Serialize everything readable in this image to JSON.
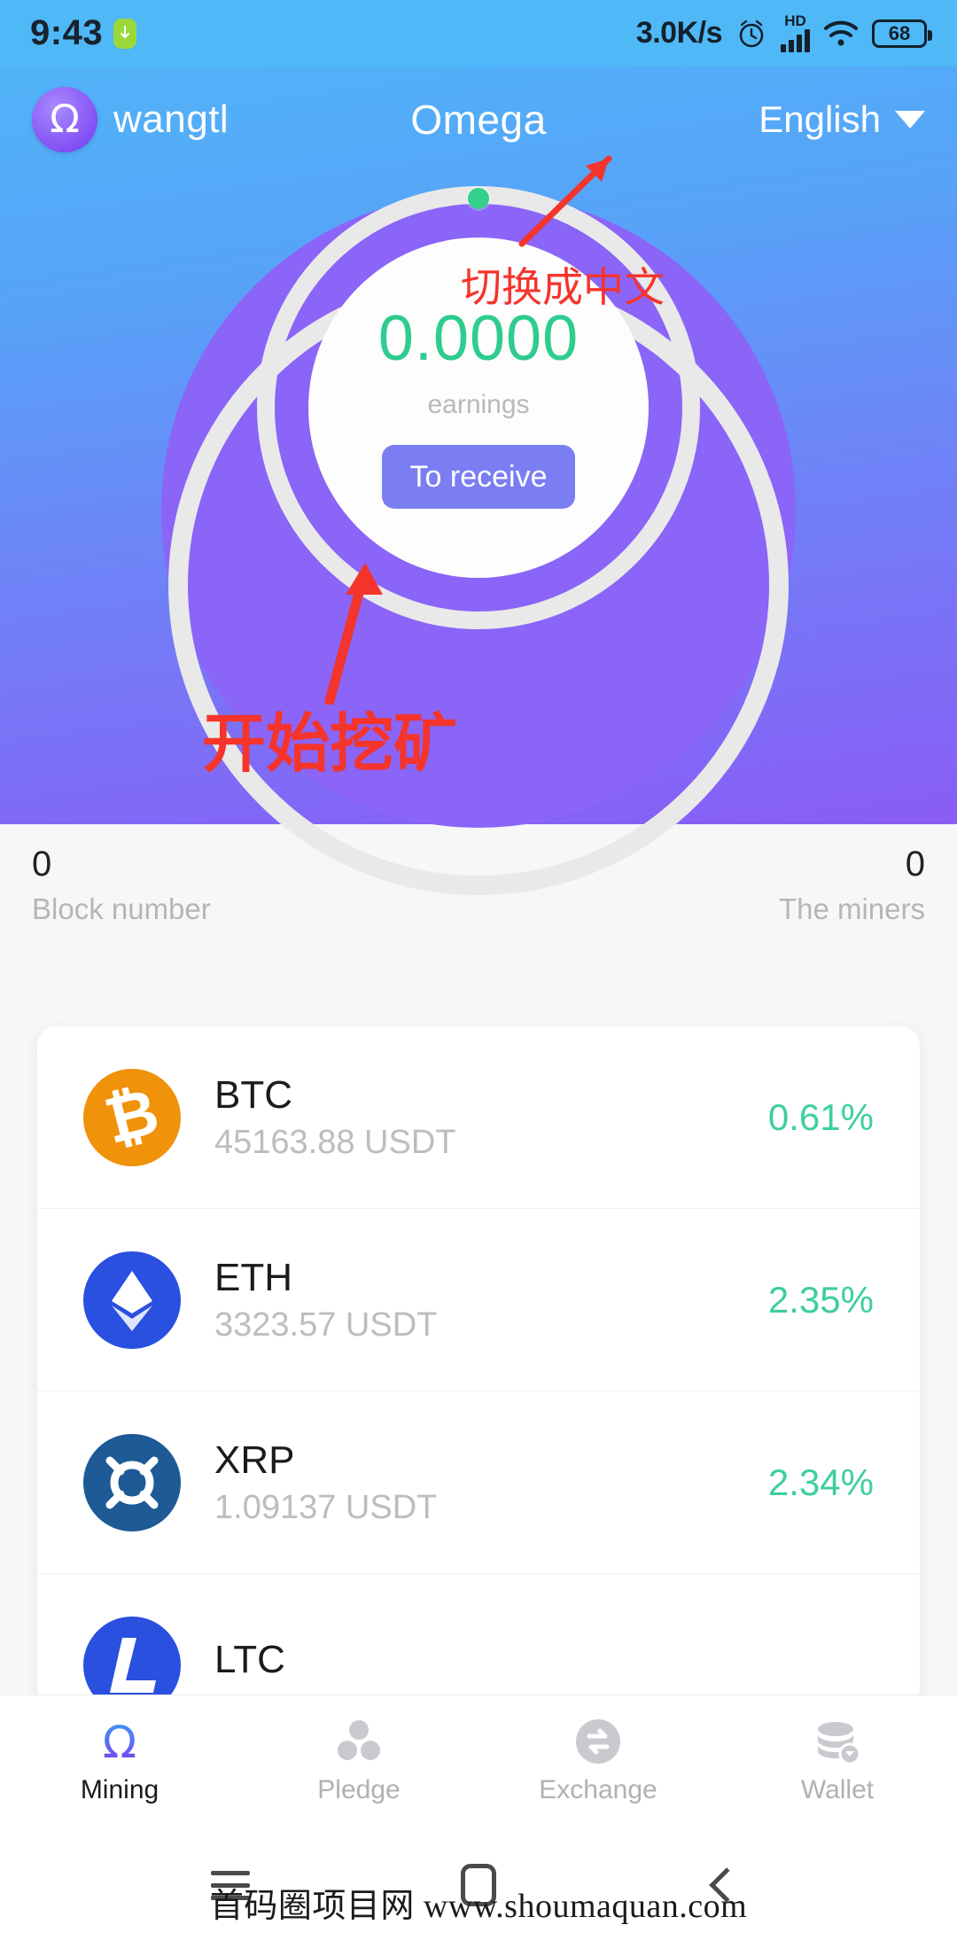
{
  "status_bar": {
    "time": "9:43",
    "download_icon": "download-badge-icon",
    "network_speed": "3.0K/s",
    "alarm_icon": "alarm-clock-icon",
    "hd_label": "HD",
    "signal_icon": "signal-bars-icon",
    "wifi_icon": "wifi-icon",
    "battery_level": "68"
  },
  "app_bar": {
    "logo_glyph": "Ω",
    "username": "wangtl",
    "title": "Omega",
    "language": "English",
    "caret_icon": "chevron-down-icon"
  },
  "earnings_ring": {
    "value": "0.0000",
    "label": "earnings",
    "button_label": "To receive",
    "dot_color": "#35d08b",
    "value_color": "#2ecc8f",
    "button_color": "#7b7ef3"
  },
  "stats": [
    {
      "value": "0",
      "label": "Block number"
    },
    {
      "value": "0",
      "label": "The miners"
    }
  ],
  "coins": [
    {
      "symbol": "BTC",
      "price": "45163.88 USDT",
      "change": "0.61%",
      "icon": "bitcoin-icon",
      "color": "#f0920a"
    },
    {
      "symbol": "ETH",
      "price": "3323.57 USDT",
      "change": "2.35%",
      "icon": "ethereum-icon",
      "color": "#2a50e0"
    },
    {
      "symbol": "XRP",
      "price": "1.09137 USDT",
      "change": "2.34%",
      "icon": "ripple-icon",
      "color": "#1d5a96"
    },
    {
      "symbol": "LTC",
      "price": "",
      "change": "",
      "icon": "litecoin-icon",
      "color": "#2a50e0"
    }
  ],
  "coin_change_color": "#3ecf9a",
  "tabs": [
    {
      "label": "Mining",
      "icon": "omega-icon",
      "active": true
    },
    {
      "label": "Pledge",
      "icon": "nodes-icon",
      "active": false
    },
    {
      "label": "Exchange",
      "icon": "exchange-icon",
      "active": false
    },
    {
      "label": "Wallet",
      "icon": "coins-icon",
      "active": false
    }
  ],
  "android_nav": {
    "menu_icon": "hamburger-menu-icon",
    "home_icon": "home-square-icon",
    "back_icon": "back-chevron-icon"
  },
  "annotations": [
    {
      "text": "切换成中文",
      "target": "language-selector"
    },
    {
      "text": "开始挖矿",
      "target": "to-receive-button"
    }
  ],
  "watermark": "首码圈项目网 www.shoumaquan.com"
}
